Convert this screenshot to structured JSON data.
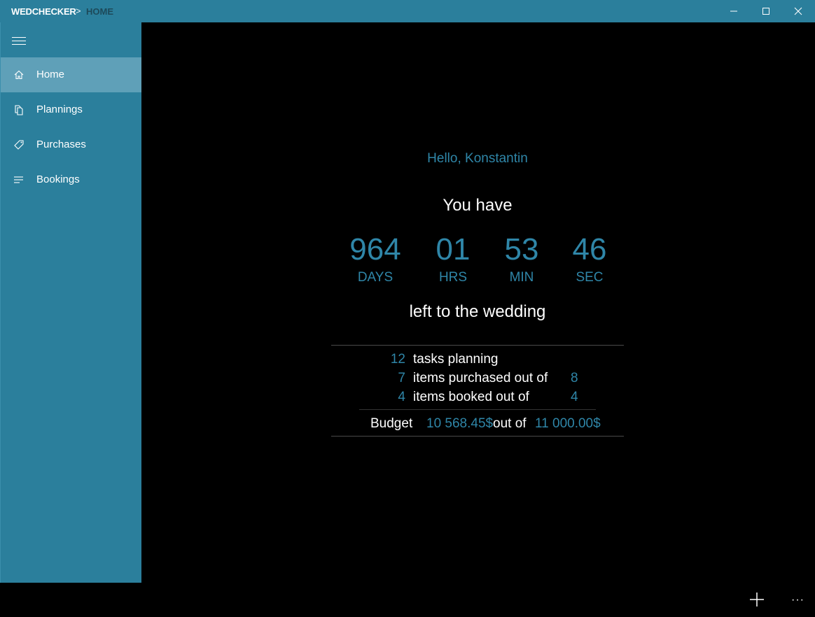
{
  "titlebar": {
    "app_name": "WEDCHECKER",
    "separator": ">",
    "page_name": "HOME"
  },
  "sidebar": {
    "items": [
      {
        "label": "Home",
        "icon": "home-icon",
        "selected": true
      },
      {
        "label": "Plannings",
        "icon": "documents-icon",
        "selected": false
      },
      {
        "label": "Purchases",
        "icon": "tag-icon",
        "selected": false
      },
      {
        "label": "Bookings",
        "icon": "list-icon",
        "selected": false
      }
    ]
  },
  "main": {
    "greeting": "Hello, Konstantin",
    "you_have": "You have",
    "countdown": {
      "days": "964",
      "days_label": "DAYS",
      "hours": "01",
      "hours_label": "HRS",
      "minutes": "53",
      "minutes_label": "MIN",
      "seconds": "46",
      "seconds_label": "SEC"
    },
    "left_to": "left to the wedding",
    "stats": {
      "tasks_count": "12",
      "tasks_label": "tasks planning",
      "purchased_count": "7",
      "purchased_label": "items purchased out of",
      "purchased_total": "8",
      "booked_count": "4",
      "booked_label": "items booked out of",
      "booked_total": "4"
    },
    "budget": {
      "label": "Budget",
      "spent": "10 568.45$",
      "out_of": "out of",
      "total": "11 000.00$"
    }
  },
  "colors": {
    "accent": "#2b7f9c",
    "selected": "#5fa0b8",
    "value_text": "#2f86a8",
    "background": "#000000"
  }
}
